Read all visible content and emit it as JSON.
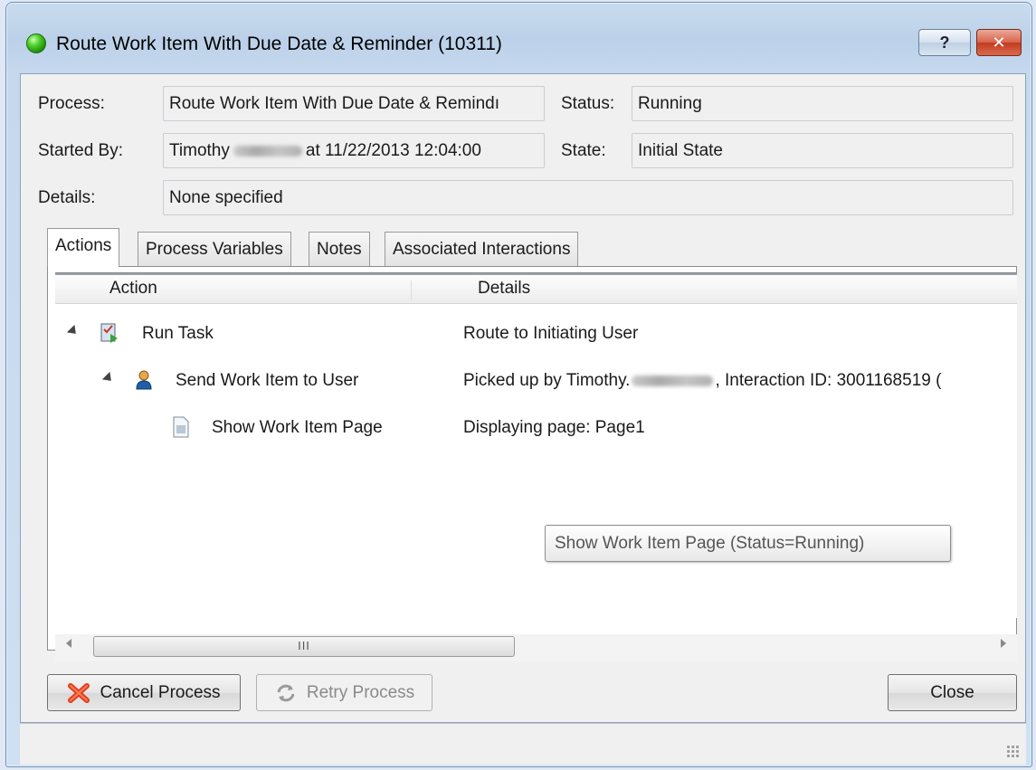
{
  "window": {
    "title": "Route Work Item With Due Date & Reminder (10311)",
    "help_label": "?",
    "close_label": "✕"
  },
  "fields": {
    "process_label": "Process:",
    "process_value": "Route Work Item With Due Date & Remindı",
    "status_label": "Status:",
    "status_value": "Running",
    "started_by_label": "Started By:",
    "started_by_first": "Timothy",
    "started_by_rest": "at 11/22/2013 12:04:00",
    "state_label": "State:",
    "state_value": "Initial State",
    "details_label": "Details:",
    "details_value": "None specified"
  },
  "tabs": [
    {
      "label": "Actions"
    },
    {
      "label": "Process Variables"
    },
    {
      "label": "Notes"
    },
    {
      "label": "Associated Interactions"
    }
  ],
  "tree": {
    "columns": {
      "action": "Action",
      "details": "Details"
    },
    "rows": [
      {
        "action": "Run Task",
        "details": "Route to Initiating User",
        "icon": "task-icon"
      },
      {
        "action": "Send Work Item to User",
        "details_prefix": "Picked up by Timothy.",
        "details_suffix": ", Interaction ID: 3001168519 (",
        "icon": "user-icon"
      },
      {
        "action": "Show Work Item Page",
        "details": "Displaying page: Page1",
        "icon": "page-icon"
      }
    ]
  },
  "tooltip": "Show Work Item Page (Status=Running)",
  "scrollbar": {
    "thumb_grip": "III"
  },
  "buttons": {
    "cancel": "Cancel Process",
    "retry": "Retry Process",
    "close": "Close"
  },
  "colors": {
    "accent": "#4fcf2a",
    "cancel_icon": "#e0401e",
    "user_icon": "#1f5fa8"
  }
}
